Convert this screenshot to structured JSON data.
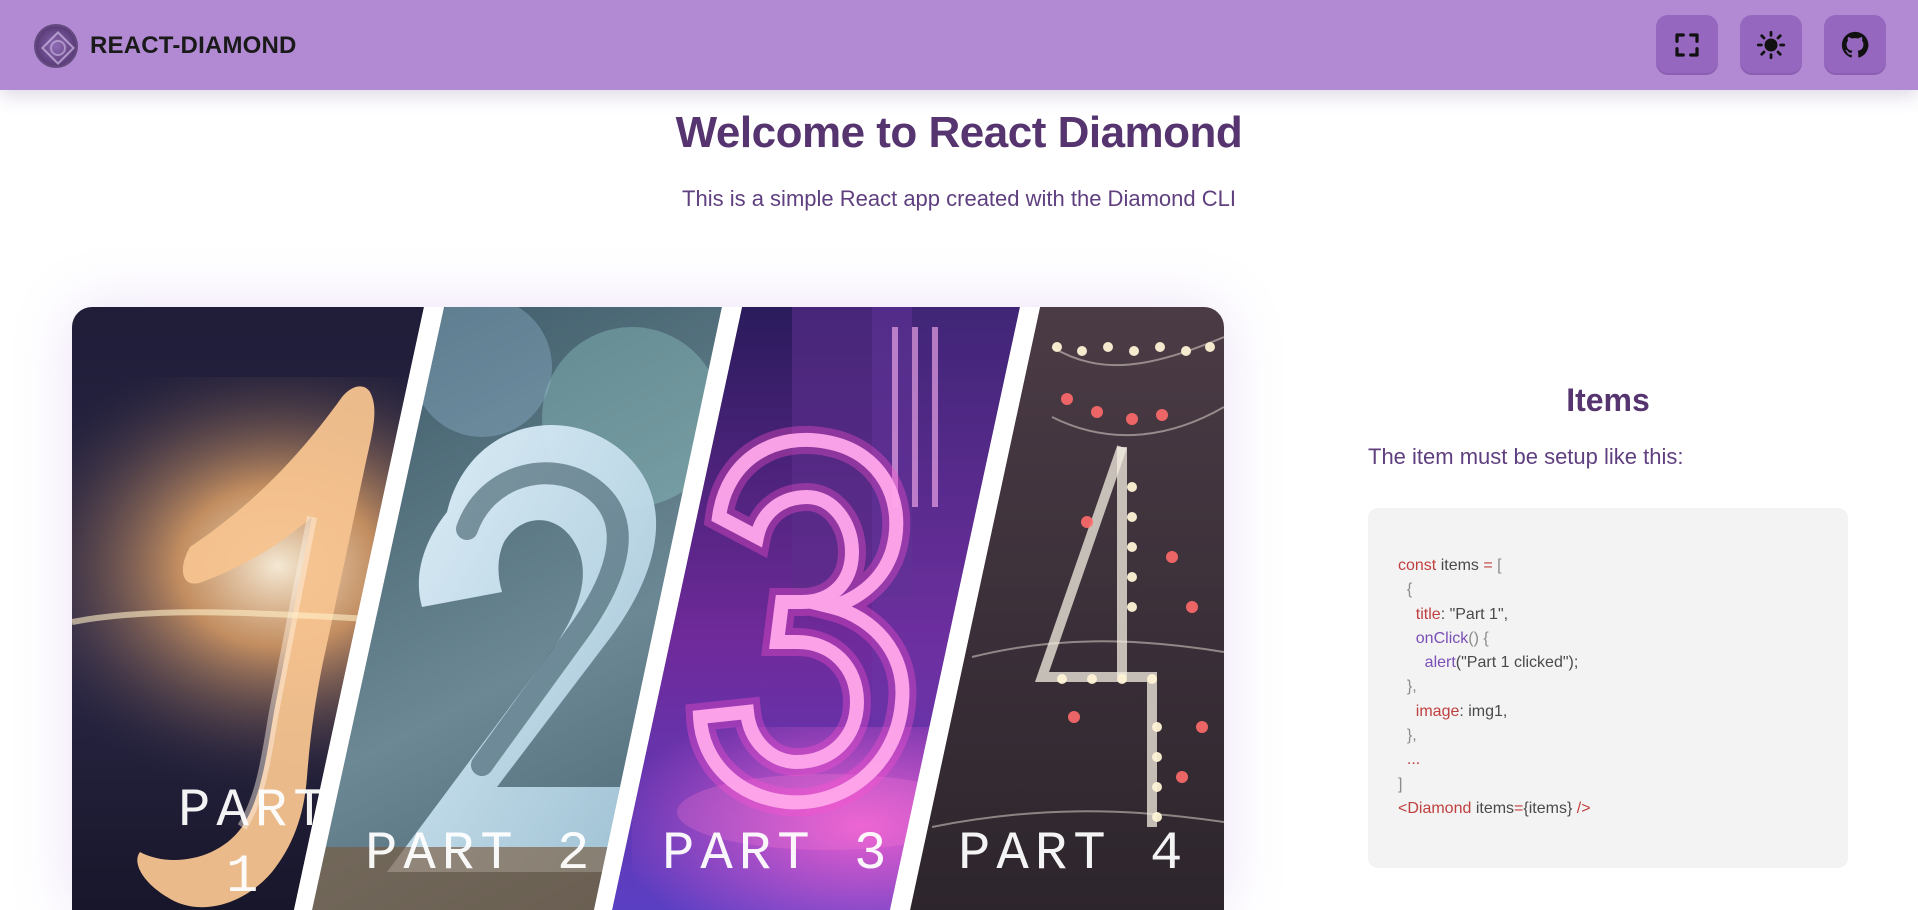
{
  "header": {
    "brand": "REACT-DIAMOND",
    "actions": [
      {
        "name": "fullscreen-button",
        "icon": "fullscreen-icon"
      },
      {
        "name": "theme-toggle-button",
        "icon": "sun-icon"
      },
      {
        "name": "github-button",
        "icon": "github-icon"
      }
    ]
  },
  "hero": {
    "title": "Welcome to React Diamond",
    "subtitle": "This is a simple React app created with the Diamond CLI"
  },
  "carousel": {
    "items": [
      {
        "label": "PART\n1",
        "numeral": "1"
      },
      {
        "label": "PART 2",
        "numeral": "2"
      },
      {
        "label": "PART 3",
        "numeral": "3"
      },
      {
        "label": "PART 4",
        "numeral": "4"
      }
    ]
  },
  "items_panel": {
    "title": "Items",
    "description": "The item must be setup like this:",
    "code": {
      "line1_kw": "const",
      "line1_rest": " items ",
      "line1_eq": "=",
      "line1_open": " [",
      "line2": "  {",
      "line3_key": "title",
      "line3_rest": ": \"Part 1\",",
      "line4_fn": "onClick",
      "line4_rest": "() {",
      "line5_fn": "alert",
      "line5_rest": "(\"Part 1 clicked\");",
      "line6": "  },",
      "line7_key": "image",
      "line7_rest": ": img1,",
      "line8": "  },",
      "line9": "  ...",
      "line10": "]",
      "line11_tag": "<Diamond",
      "line11_attr": " items",
      "line11_eq": "=",
      "line11_val": "{items}",
      "line11_end": " />"
    }
  },
  "colors": {
    "header": "#b18ad3",
    "icon_button": "#9667bf",
    "heading": "#56346f"
  }
}
